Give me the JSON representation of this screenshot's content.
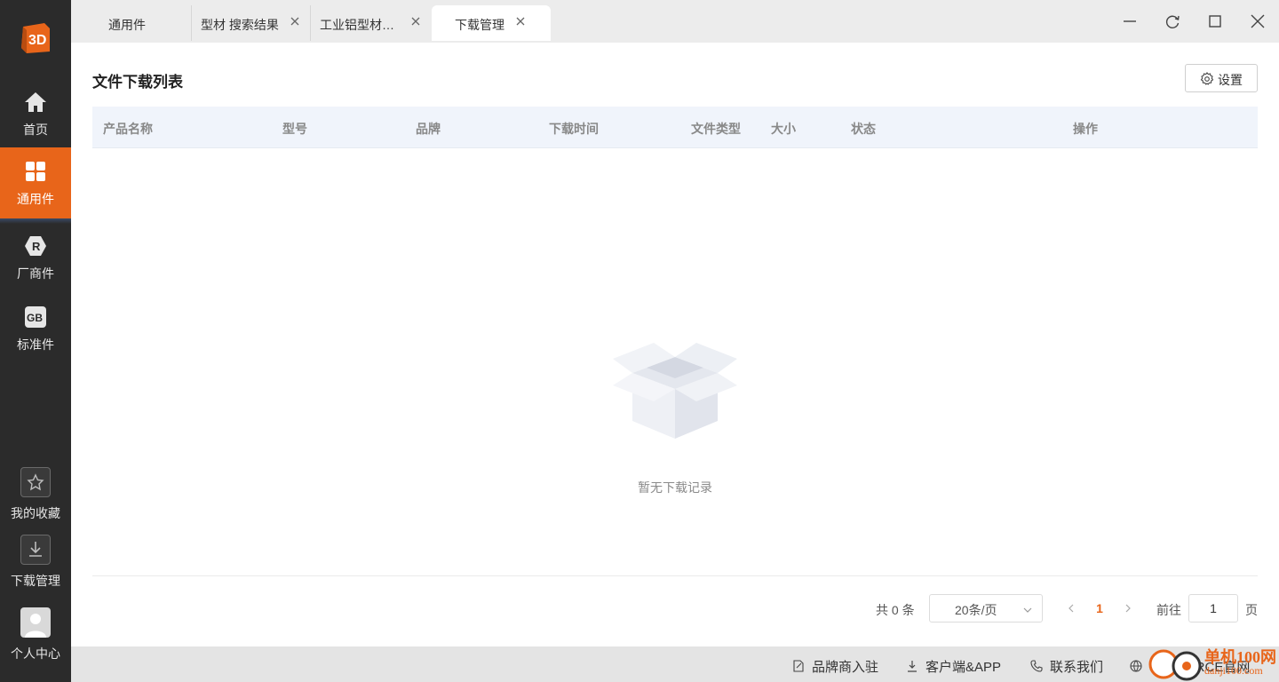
{
  "app": {
    "logo_text": "3D",
    "accent": "#e8651a",
    "sidebar_bg": "#2b2b2b"
  },
  "sidebar": {
    "items": [
      {
        "label": "首页",
        "icon": "home-icon",
        "active": false
      },
      {
        "label": "通用件",
        "icon": "grid-icon",
        "active": true
      },
      {
        "label": "厂商件",
        "icon": "hexagon-r-icon",
        "icon_text": "R",
        "active": false
      },
      {
        "label": "标准件",
        "icon": "gb-badge-icon",
        "icon_text": "GB",
        "active": false
      }
    ],
    "bottom": [
      {
        "label": "我的收藏",
        "icon": "star-folder-icon"
      },
      {
        "label": "下载管理",
        "icon": "download-icon"
      },
      {
        "label": "个人中心",
        "icon": "avatar-icon"
      }
    ]
  },
  "tabs": [
    {
      "label": "通用件",
      "closable": false,
      "active": false
    },
    {
      "label": "型材 搜索结果",
      "closable": true,
      "active": false
    },
    {
      "label": "工业铝型材…",
      "closable": true,
      "active": false
    },
    {
      "label": "下载管理",
      "closable": true,
      "active": true
    }
  ],
  "window_controls": [
    "minimize-icon",
    "refresh-icon",
    "maximize-icon",
    "close-icon"
  ],
  "main": {
    "title": "文件下载列表",
    "settings_label": "设置",
    "columns": [
      "产品名称",
      "型号",
      "品牌",
      "下载时间",
      "文件类型",
      "大小",
      "状态",
      "操作"
    ],
    "rows": [],
    "empty_text": "暂无下载记录"
  },
  "pagination": {
    "total_text": "共 0 条",
    "page_size": "20条/页",
    "current_page": "1",
    "goto_label": "前往",
    "goto_value": "1",
    "goto_suffix": "页"
  },
  "footer": {
    "links": [
      {
        "label": "品牌商入驻",
        "icon": "edit-icon"
      },
      {
        "label": "客户端&APP",
        "icon": "download-icon"
      },
      {
        "label": "联系我们",
        "icon": "phone-icon"
      },
      {
        "label": "3DSOURCE官网",
        "icon": "globe-icon"
      }
    ]
  },
  "watermark": {
    "line1": "单机100网",
    "line2": "danji100.com"
  }
}
